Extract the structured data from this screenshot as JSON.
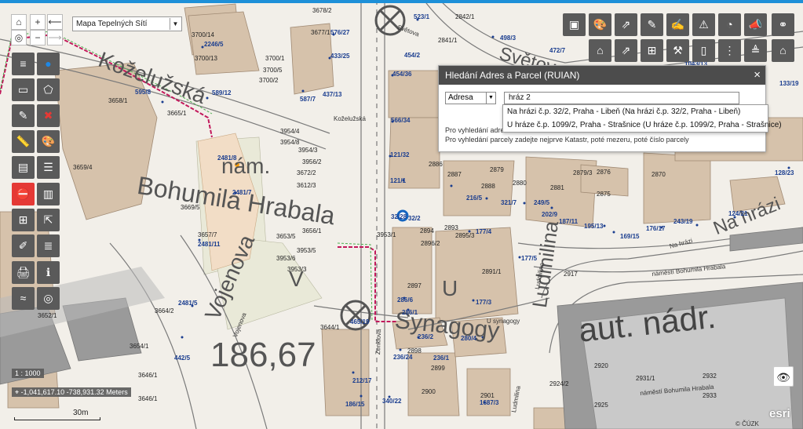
{
  "map": {
    "basemap": "Mapa Tepelných Sítí",
    "street_names_large": [
      {
        "text": "Koželužská"
      },
      {
        "text": "nám."
      },
      {
        "text": "Bohumila Hrabala"
      },
      {
        "text": "Vojenova"
      },
      {
        "text": "Synagogy"
      },
      {
        "text": "aut. nádr."
      },
      {
        "text": "186,67"
      },
      {
        "text": "Ludmilina"
      },
      {
        "text": "Na hrázi"
      },
      {
        "text": "V"
      },
      {
        "text": "U"
      },
      {
        "text": "Světova"
      }
    ],
    "street_names_small": [
      "Koželužská",
      "Vojenova",
      "náměstí Bohumila Hrabala",
      "náměstí Bohumila Hrabala",
      "U synagogy",
      "Na hrázi",
      "Světova",
      "Ludmilina",
      "Ludmilina",
      "Zenklova"
    ],
    "address_labels": [
      "523/1",
      "498/3",
      "472/7",
      "576/27",
      "433/25",
      "437/13",
      "587/7",
      "589/12",
      "595/8",
      "2246/5",
      "454/2",
      "454/36",
      "566/34",
      "121/32",
      "121/1",
      "32/28",
      "32/2",
      "216/5",
      "321/7",
      "187/11",
      "195/13",
      "202/9",
      "249/5",
      "169/15",
      "176/17",
      "243/19",
      "124/21",
      "128/23",
      "133/19",
      "177/4",
      "177/5",
      "177/3",
      "286/6",
      "286/1",
      "280/4",
      "236/2",
      "236/24",
      "465/19",
      "212/17",
      "186/15",
      "340/22",
      "1687/3",
      "2481/11",
      "2481/5",
      "2481/7",
      "2481/8",
      "1043/13",
      "442/5",
      "236/1"
    ],
    "parcel_labels": [
      "2842/1",
      "3678/2",
      "3677/1",
      "3700/14",
      "3700/13",
      "3700/5",
      "3700/2",
      "3700/1",
      "3658/1",
      "3665/1",
      "3659/4",
      "3669/5",
      "3657/7",
      "3653/5",
      "3656/1",
      "3652/1",
      "3654/1",
      "3646/1",
      "3954/4",
      "3954/8",
      "3954/3",
      "3956/2",
      "3672/2",
      "3612/3",
      "3953/6",
      "3953/3",
      "3953/5",
      "3953/1",
      "3644/1",
      "3664/2",
      "3646/1",
      "2886",
      "2887",
      "2888",
      "2879",
      "2880",
      "2881",
      "2896/2",
      "2897",
      "2898",
      "2899",
      "2900",
      "2901",
      "2891/1",
      "2917",
      "2924/2",
      "2925",
      "2931/1",
      "2932",
      "2933",
      "2920",
      "2879/3",
      "2875",
      "2870",
      "2841/1",
      "2876",
      "2893",
      "2895/3",
      "2894"
    ],
    "markers": {
      "location_color": "#1565c0"
    },
    "accent_colors": {
      "selection": "#e53935",
      "route": "#c2185b",
      "topbar": "#1e90d8"
    }
  },
  "nav": {
    "home_icon": "home-icon",
    "zoom_in": "+",
    "zoom_out": "−",
    "locate_icon": "locate-icon",
    "back_icon": "arrow-left-icon",
    "forward_icon": "arrow-right-icon"
  },
  "left_tools": [
    {
      "name": "layers-tool",
      "icon": "≡"
    },
    {
      "name": "legend-tool",
      "icon": "●"
    },
    {
      "name": "select-rectangle-tool",
      "icon": "▭"
    },
    {
      "name": "select-polygon-tool",
      "icon": "⬠"
    },
    {
      "name": "measure-tool",
      "icon": "✎"
    },
    {
      "name": "clear-selection-tool",
      "icon": "✖"
    },
    {
      "name": "ruler-tool",
      "icon": "📏"
    },
    {
      "name": "draw-tool",
      "icon": "🎨"
    },
    {
      "name": "table-tool",
      "icon": "▤"
    },
    {
      "name": "list-tool",
      "icon": "☰"
    },
    {
      "name": "filter-tool",
      "icon": "⛔"
    },
    {
      "name": "chart-tool",
      "icon": "▥"
    },
    {
      "name": "grid-tool",
      "icon": "⊞"
    },
    {
      "name": "export-tool",
      "icon": "⇱"
    },
    {
      "name": "annotate-tool",
      "icon": "✐"
    },
    {
      "name": "attribute-tool",
      "icon": "≣"
    },
    {
      "name": "print-tool",
      "icon": "🖨"
    },
    {
      "name": "info-tool",
      "icon": "ℹ"
    },
    {
      "name": "wave-tool",
      "icon": "≈"
    },
    {
      "name": "compass-tool",
      "icon": "◎"
    }
  ],
  "right_tools": [
    {
      "name": "basemap-tool",
      "icon": "▣"
    },
    {
      "name": "palette-tool",
      "icon": "🎨"
    },
    {
      "name": "share-tool",
      "icon": "⇗"
    },
    {
      "name": "edit-tool",
      "icon": "✎"
    },
    {
      "name": "draw-tool-right",
      "icon": "✍"
    },
    {
      "name": "warning-tool",
      "icon": "⚠"
    },
    {
      "name": "gauge-tool",
      "icon": "◔"
    },
    {
      "name": "announce-tool",
      "icon": "📣"
    },
    {
      "name": "pipes-tool",
      "icon": "⚭"
    },
    {
      "name": "building-tool",
      "icon": "⌂"
    },
    {
      "name": "palette-tool-2",
      "icon": "✿"
    },
    {
      "name": "open-external-tool",
      "icon": "⇗"
    },
    {
      "name": "dashboard-tool",
      "icon": "⊞"
    },
    {
      "name": "hammer-tool",
      "icon": "⚒"
    },
    {
      "name": "mobile-tool",
      "icon": "▯"
    },
    {
      "name": "network-tool",
      "icon": "⋮"
    },
    {
      "name": "stack-tool",
      "icon": "≜"
    },
    {
      "name": "home-tool",
      "icon": "⌂"
    }
  ],
  "search_dialog": {
    "title": "Hledání Adres a Parcel (RUIAN)",
    "close": "×",
    "type_value": "Adresa",
    "query": "hráz 2",
    "help_line1": "Pro vyhledání adres",
    "help_line2": "Pro vyhledání parcely zadejte nejprve Katastr, poté mezeru, poté číslo parcely",
    "suggestions": [
      "Na hrázi č.p. 32/2, Praha - Libeň (Na hrázi č.p. 32/2, Praha - Libeň)",
      "U hráze č.p. 1099/2, Praha - Strašnice (U hráze č.p. 1099/2, Praha - Strašnice)"
    ]
  },
  "status": {
    "scale": "1 : 1000",
    "coordinates": "-1,041,617.10 -738,931.32 Meters",
    "scalebar_label": "30m",
    "copyright": "© ČÚZK",
    "esri": "esri"
  },
  "eye_icon": "eye-icon"
}
